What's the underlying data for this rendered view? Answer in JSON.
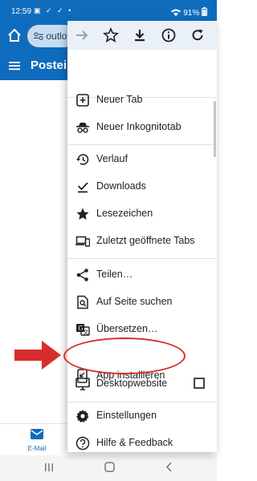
{
  "status_bar": {
    "time": "12:59",
    "icons": "▣ ✓ ✓ •",
    "battery": "91%"
  },
  "chrome": {
    "address_text": "outlo"
  },
  "app": {
    "title": "Postein"
  },
  "bottom_nav": {
    "mail_label": "E-Mail"
  },
  "menu": {
    "items": [
      {
        "label": "Neuer Tab",
        "icon": "plus-box-icon"
      },
      {
        "label": "Neuer Inkognitotab",
        "icon": "incognito-icon"
      },
      {
        "label": "Verlauf",
        "icon": "history-icon"
      },
      {
        "label": "Downloads",
        "icon": "download-done-icon"
      },
      {
        "label": "Lesezeichen",
        "icon": "star-icon"
      },
      {
        "label": "Zuletzt geöffnete Tabs",
        "icon": "devices-icon"
      },
      {
        "label": "Teilen…",
        "icon": "share-icon"
      },
      {
        "label": "Auf Seite suchen",
        "icon": "find-in-page-icon"
      },
      {
        "label": "Übersetzen…",
        "icon": "translate-icon"
      },
      {
        "label": "App installieren",
        "icon": "install-app-icon"
      },
      {
        "label": "Desktopwebsite",
        "icon": "desktop-icon"
      },
      {
        "label": "Einstellungen",
        "icon": "settings-icon"
      },
      {
        "label": "Hilfe & Feedback",
        "icon": "help-icon"
      }
    ]
  },
  "colors": {
    "brand": "#0f6cbd",
    "annotation": "#d72d2d"
  }
}
